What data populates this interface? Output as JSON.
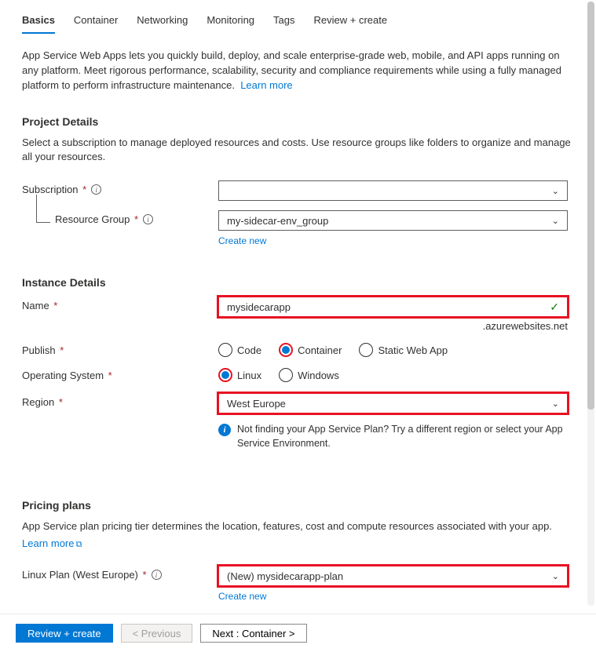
{
  "tabs": {
    "basics": "Basics",
    "container": "Container",
    "networking": "Networking",
    "monitoring": "Monitoring",
    "tags": "Tags",
    "review": "Review + create"
  },
  "intro": {
    "text": "App Service Web Apps lets you quickly build, deploy, and scale enterprise-grade web, mobile, and API apps running on any platform. Meet rigorous performance, scalability, security and compliance requirements while using a fully managed platform to perform infrastructure maintenance.",
    "learn_more": "Learn more"
  },
  "project_details": {
    "heading": "Project Details",
    "desc": "Select a subscription to manage deployed resources and costs. Use resource groups like folders to organize and manage all your resources.",
    "subscription_label": "Subscription",
    "subscription_value": "",
    "resource_group_label": "Resource Group",
    "resource_group_value": "my-sidecar-env_group",
    "create_new": "Create new"
  },
  "instance_details": {
    "heading": "Instance Details",
    "name_label": "Name",
    "name_value": "mysidecarapp",
    "name_suffix": ".azurewebsites.net",
    "publish_label": "Publish",
    "publish_options": {
      "code": "Code",
      "container": "Container",
      "static": "Static Web App"
    },
    "os_label": "Operating System",
    "os_options": {
      "linux": "Linux",
      "windows": "Windows"
    },
    "region_label": "Region",
    "region_value": "West Europe",
    "region_hint": "Not finding your App Service Plan? Try a different region or select your App Service Environment."
  },
  "pricing": {
    "heading": "Pricing plans",
    "desc": "App Service plan pricing tier determines the location, features, cost and compute resources associated with your app.",
    "learn_more": "Learn more",
    "plan_label": "Linux Plan (West Europe)",
    "plan_value": "(New) mysidecarapp-plan",
    "create_new": "Create new"
  },
  "footer": {
    "review": "Review + create",
    "previous": "< Previous",
    "next": "Next : Container >"
  }
}
